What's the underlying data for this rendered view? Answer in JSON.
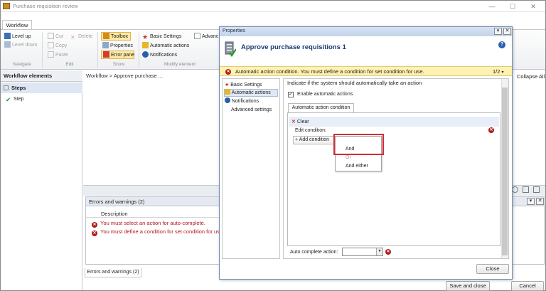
{
  "window": {
    "title": "Purchase requisition review"
  },
  "ribbon": {
    "tab": "Workflow",
    "level_up": "Level up",
    "level_down": "Level down",
    "cut": "Cut",
    "delete": "Delete",
    "copy": "Copy",
    "paste": "Paste",
    "toolbox": "Toolbox",
    "properties": "Properties",
    "error_pane": "Error pane",
    "basic_settings": "Basic Settings",
    "advanced": "Advanc",
    "automatic_actions": "Automatic actions",
    "notifications": "Notifications",
    "groups": {
      "navigate": "Navigate",
      "edit": "Edit",
      "show": "Show",
      "modify": "Modify element"
    }
  },
  "left_pane": {
    "header": "Workflow elements",
    "steps": "Steps",
    "step_item": "Step"
  },
  "breadcrumb": "Workflow  >  Approve purchase ...",
  "collapse_all": "Collapse All",
  "errors": {
    "header": "Errors and warnings (2)",
    "column": "Description",
    "rows": [
      "You must select an action for auto-complete.",
      "You must define a condition for set condition for us"
    ],
    "tab": "Errors and warnings (2)"
  },
  "footer": {
    "save_close": "Save and close",
    "cancel": "Cancel"
  },
  "dialog": {
    "title": "Properties",
    "heading": "Approve purchase requisitions 1",
    "warning": "Automatic action condition. You must define a condition for set condition for use.",
    "pager": "1/2",
    "nav": [
      "Basic Settings",
      "Automatic actions",
      "Notifications",
      "Advanced settings"
    ],
    "question": "Indicate if the system should automatically take an action",
    "enable_label": "Enable automatic actions",
    "enable_checked": "✓",
    "subtab": "Automatic action condition",
    "clear": "Clear",
    "edit_condition": "Edit condition:",
    "add_condition": "Add condition",
    "menu": [
      "And",
      "Or",
      "And either"
    ],
    "auto_complete_label": "Auto complete action:",
    "close": "Close"
  },
  "colors": {
    "accent": "#1a3c74",
    "error": "#b11b1b",
    "warning_bg": "#fdf1b4",
    "highlight": "#d42b35"
  }
}
